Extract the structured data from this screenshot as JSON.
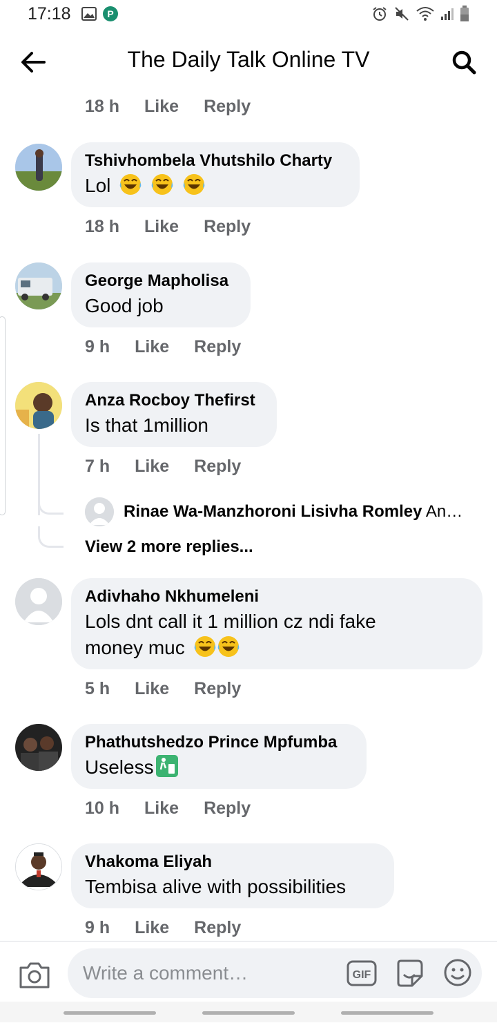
{
  "status_bar": {
    "time": "17:18",
    "left_icons": [
      "image-icon",
      "p-app-icon"
    ],
    "right_icons": [
      "alarm-icon",
      "mute-icon",
      "wifi-icon",
      "signal-icon",
      "battery-icon"
    ]
  },
  "header": {
    "title": "The Daily Talk Online TV",
    "back_icon": "arrow-left-icon",
    "search_icon": "search-icon"
  },
  "actions": {
    "like": "Like",
    "reply": "Reply"
  },
  "top_meta": {
    "time": "18 h"
  },
  "comments": [
    {
      "author": "Tshivhombela Vhutshilo Charty",
      "text": "Lol",
      "emoji": [
        "face-with-tears-of-joy",
        "face-with-tears-of-joy",
        "face-with-tears-of-joy"
      ],
      "time": "18 h"
    },
    {
      "author": "George Mapholisa",
      "text": "Good job",
      "time": "9 h"
    },
    {
      "author": "Anza Rocboy Thefirst",
      "text": "Is that 1million",
      "time": "7 h"
    },
    {
      "author": "Adivhaho Nkhumeleni",
      "text_line1": "Lols dnt call it 1 million cz ndi fake",
      "text_line2": "money muc",
      "emoji": [
        "face-with-tears-of-joy",
        "face-with-tears-of-joy"
      ],
      "time": "5 h"
    },
    {
      "author": "Phathutshedzo Prince Mpfumba",
      "text": "Useless",
      "emoji": [
        "litter-in-bin-sign"
      ],
      "time": "10 h"
    },
    {
      "author": "Vhakoma Eliyah",
      "text": "Tembisa alive with possibilities",
      "time": "9 h"
    }
  ],
  "reply_preview": {
    "author": "Rinae Wa-Manzhoroni Lisivha Romley",
    "snippet": "An…",
    "view_more": "View 2 more replies..."
  },
  "composer": {
    "placeholder": "Write a comment…",
    "gif_label": "GIF",
    "icons": [
      "camera-icon",
      "gif-icon",
      "sticker-icon",
      "emoji-icon"
    ]
  },
  "colors": {
    "bubble": "#f0f2f5",
    "meta": "#65676b",
    "text": "#050505"
  }
}
